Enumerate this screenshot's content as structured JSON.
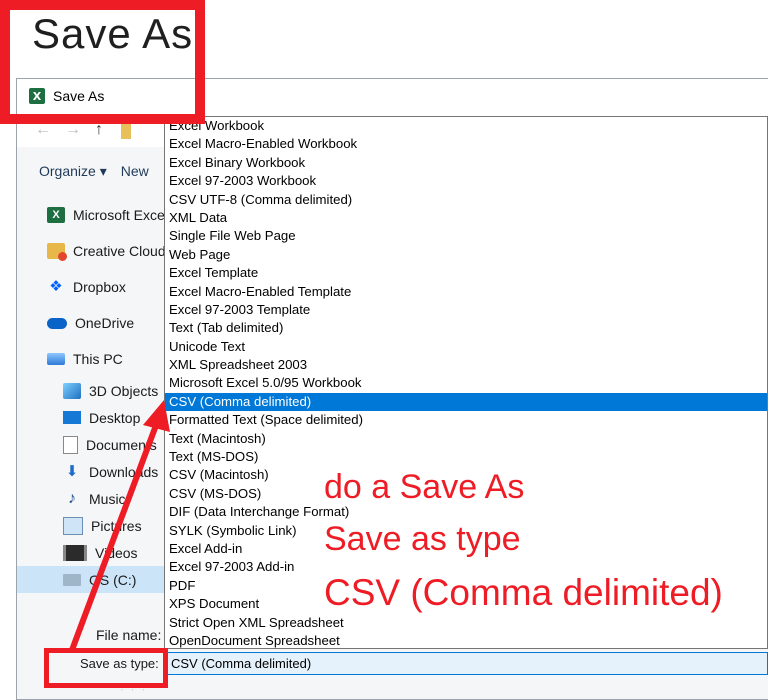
{
  "page_heading": "Save As",
  "dialog": {
    "title": "Save As",
    "app_icon_letter": "X"
  },
  "toolbar": {
    "organize_label": "Organize ▾",
    "new_label": "New"
  },
  "sidebar": {
    "items": [
      {
        "label": "Microsoft Excel",
        "icon": "excel-icon"
      },
      {
        "label": "Creative Cloud",
        "icon": "creative-cloud-icon"
      },
      {
        "label": "Dropbox",
        "icon": "dropbox-icon"
      },
      {
        "label": "OneDrive",
        "icon": "onedrive-icon"
      },
      {
        "label": "This PC",
        "icon": "pc-icon"
      },
      {
        "label": "3D Objects",
        "icon": "3d-objects-icon"
      },
      {
        "label": "Desktop",
        "icon": "desktop-icon"
      },
      {
        "label": "Documents",
        "icon": "documents-icon"
      },
      {
        "label": "Downloads",
        "icon": "downloads-icon"
      },
      {
        "label": "Music",
        "icon": "music-icon"
      },
      {
        "label": "Pictures",
        "icon": "pictures-icon"
      },
      {
        "label": "Videos",
        "icon": "videos-icon"
      },
      {
        "label": "OS (C:)",
        "icon": "drive-icon"
      }
    ]
  },
  "file_types": [
    "Excel Workbook",
    "Excel Macro-Enabled Workbook",
    "Excel Binary Workbook",
    "Excel 97-2003 Workbook",
    "CSV UTF-8 (Comma delimited)",
    "XML Data",
    "Single File Web Page",
    "Web Page",
    "Excel Template",
    "Excel Macro-Enabled Template",
    "Excel 97-2003 Template",
    "Text (Tab delimited)",
    "Unicode Text",
    "XML Spreadsheet 2003",
    "Microsoft Excel 5.0/95 Workbook",
    "CSV (Comma delimited)",
    "Formatted Text (Space delimited)",
    "Text (Macintosh)",
    "Text (MS-DOS)",
    "CSV (Macintosh)",
    "CSV (MS-DOS)",
    "DIF (Data Interchange Format)",
    "SYLK (Symbolic Link)",
    "Excel Add-in",
    "Excel 97-2003 Add-in",
    "PDF",
    "XPS Document",
    "Strict Open XML Spreadsheet",
    "OpenDocument Spreadsheet"
  ],
  "selected_type_index": 15,
  "form": {
    "file_name_label": "File name:",
    "save_as_type_label": "Save as type:",
    "save_as_type_value": "CSV (Comma delimited)"
  },
  "annotations": {
    "line1": "do a Save As",
    "line2": "Save as type",
    "line3": "CSV (Comma delimited)",
    "color": "#ee1c25"
  },
  "colors": {
    "selection": "#0078d7",
    "excel_green": "#1d6f42"
  }
}
